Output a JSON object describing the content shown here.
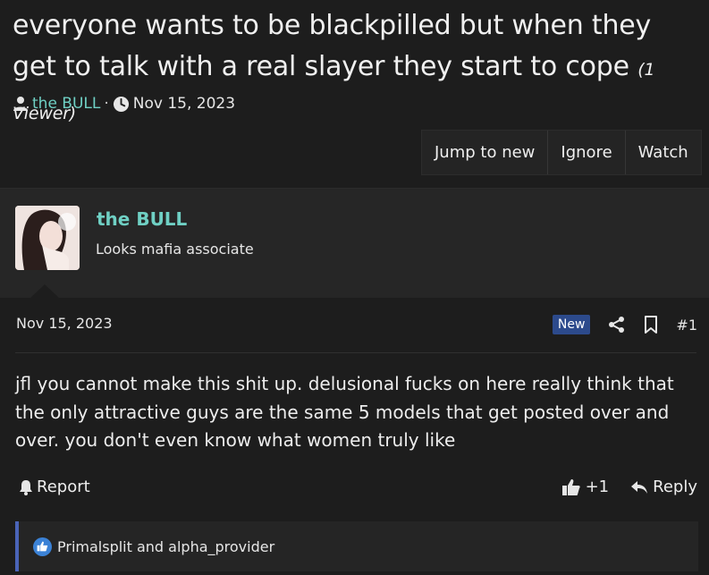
{
  "thread": {
    "title": "everyone wants to be blackpilled but when they get to talk with a real slayer they start to cope",
    "viewers": "(1 Viewer)",
    "author": "the BULL",
    "separator": "·",
    "date": "Nov 15, 2023"
  },
  "toolbar": {
    "jump_label": "Jump to new",
    "ignore_label": "Ignore",
    "watch_label": "Watch"
  },
  "post": {
    "username": "the BULL",
    "user_title": "Looks mafia associate",
    "date": "Nov 15, 2023",
    "badge": "New",
    "number": "#1",
    "body": "jfl you cannot make this shit up. delusional fucks on here really think that the only attractive guys are the same 5 models that get posted over and over. you don't even know what women truly like",
    "report_label": "Report",
    "like_count": "+1",
    "reply_label": "Reply",
    "reactions_text": "Primalsplit and alpha_provider"
  },
  "colors": {
    "username": "#6fd0c4",
    "new_badge": "#2c4a8c",
    "reaction_bar": "#4a64b8",
    "like_bubble": "#3b82d6"
  },
  "icons": {
    "meta_user": "user-icon",
    "meta_clock": "clock-icon",
    "share": "share-icon",
    "bookmark": "bookmark-icon",
    "report": "bell-icon",
    "like": "thumbs-up-icon",
    "reply": "reply-icon",
    "reaction": "like-reaction-icon"
  }
}
